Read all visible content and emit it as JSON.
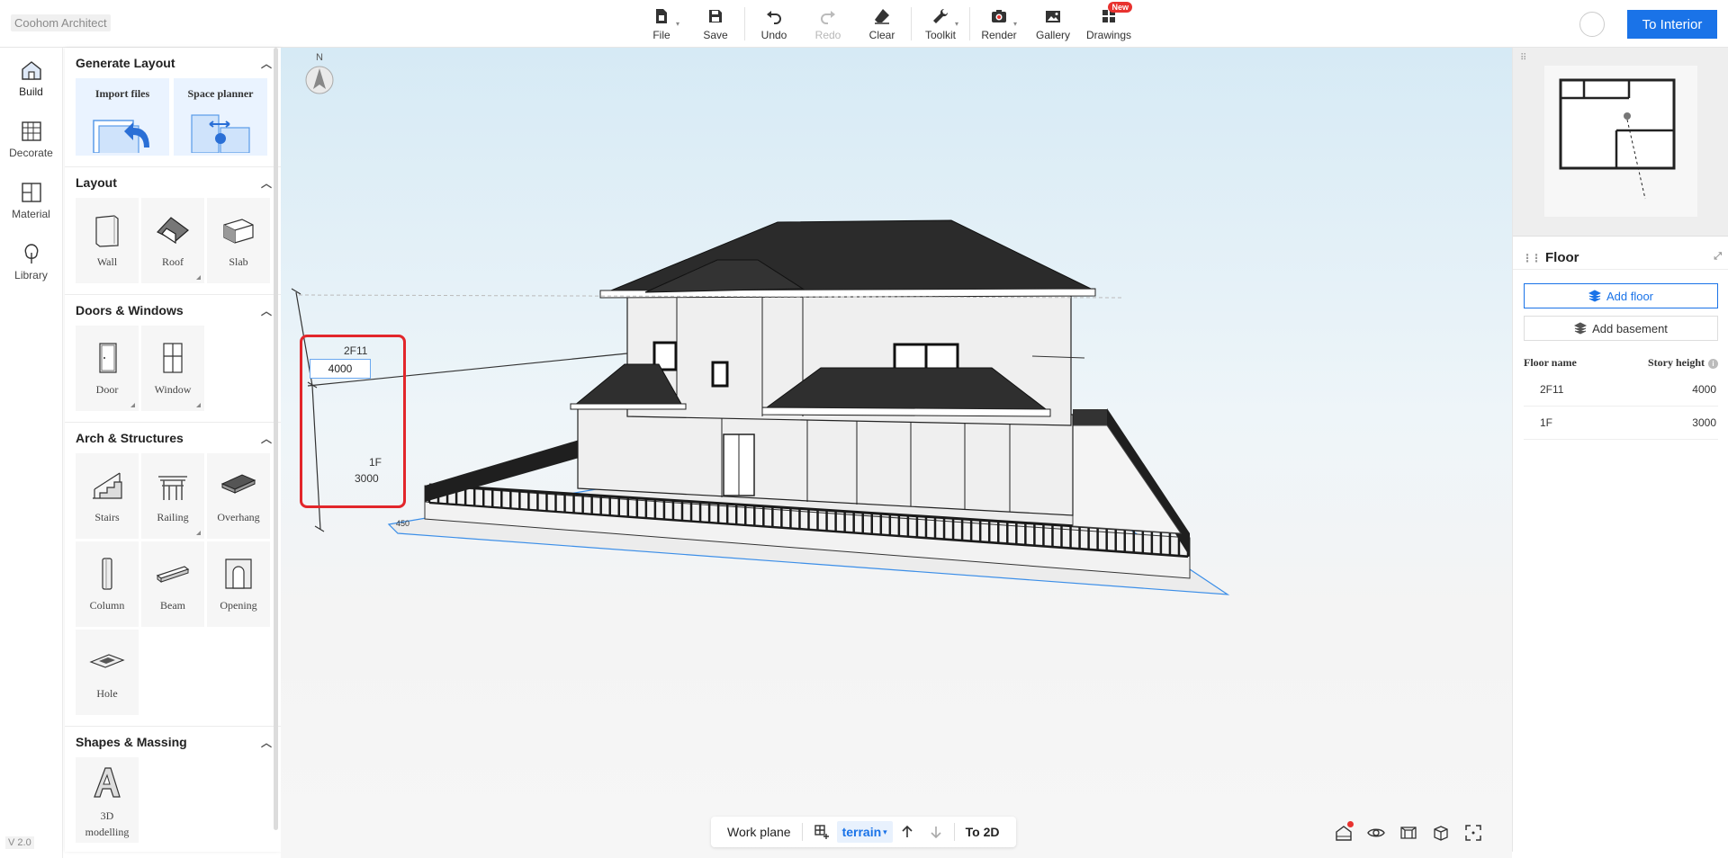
{
  "app": {
    "brand": "Coohom Architect",
    "version": "V 2.0"
  },
  "toolbar": {
    "file": "File",
    "save": "Save",
    "undo": "Undo",
    "redo": "Redo",
    "clear": "Clear",
    "toolkit": "Toolkit",
    "render": "Render",
    "gallery": "Gallery",
    "drawings": "Drawings",
    "new_badge": "New",
    "to_interior": "To Interior"
  },
  "rail": {
    "build": "Build",
    "decorate": "Decorate",
    "material": "Material",
    "library": "Library"
  },
  "panel": {
    "generate_layout": {
      "title": "Generate Layout",
      "import_files": "Import files",
      "space_planner": "Space planner"
    },
    "layout": {
      "title": "Layout",
      "items": [
        "Wall",
        "Roof",
        "Slab"
      ]
    },
    "doors_windows": {
      "title": "Doors & Windows",
      "items": [
        "Door",
        "Window"
      ]
    },
    "arch_structures": {
      "title": "Arch & Structures",
      "items": [
        "Stairs",
        "Railing",
        "Overhang",
        "Column",
        "Beam",
        "Opening",
        "Hole"
      ]
    },
    "shapes_massing": {
      "title": "Shapes & Massing",
      "items": [
        "3D modelling"
      ]
    }
  },
  "viewport": {
    "compass_n": "N",
    "upper_floor_label": "2F11",
    "upper_height_value": "4000",
    "lower_floor_label": "1F",
    "lower_height": "3000",
    "ground_dim": "450"
  },
  "bottom_bar": {
    "work_plane": "Work plane",
    "terrain": "terrain",
    "to_2d": "To 2D"
  },
  "floor_panel": {
    "title": "Floor",
    "add_floor": "Add floor",
    "add_basement": "Add basement",
    "col_name": "Floor name",
    "col_height": "Story height",
    "rows": [
      {
        "name": "2F11",
        "height": "4000"
      },
      {
        "name": "1F",
        "height": "3000"
      }
    ]
  },
  "colors": {
    "accent": "#1a73e8",
    "highlight": "#e2262b",
    "badge": "#e8322f"
  }
}
